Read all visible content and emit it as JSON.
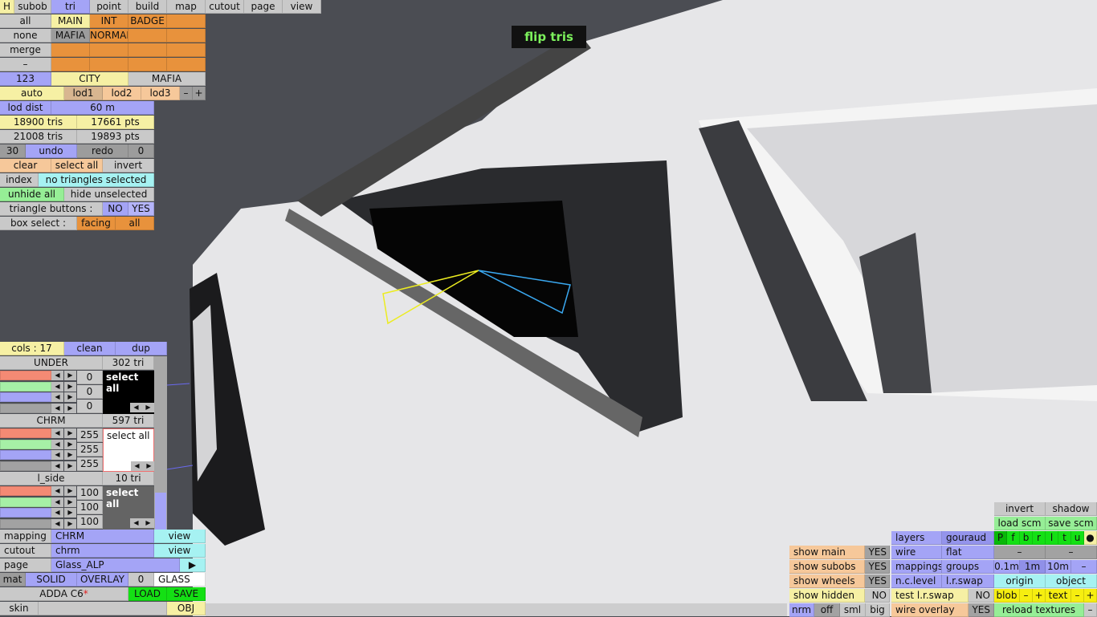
{
  "top_tabs": [
    "H",
    "subob",
    "tri",
    "point",
    "build",
    "map",
    "cutout",
    "page",
    "view"
  ],
  "layers": {
    "left": [
      "all",
      "none",
      "merge",
      "–"
    ],
    "grid": [
      [
        "MAIN",
        "INT",
        "BADGE",
        ""
      ],
      [
        "MAFIA",
        "NORMAL",
        "",
        ""
      ],
      [
        "",
        "",
        "",
        ""
      ],
      [
        "",
        "",
        "",
        ""
      ]
    ]
  },
  "city_row": [
    "123",
    "CITY",
    "MAFIA"
  ],
  "lod_row": [
    "auto",
    "lod1",
    "lod2",
    "lod3",
    "–",
    "+"
  ],
  "lod_dist": {
    "label": "lod dist",
    "value": "60 m"
  },
  "counts": [
    [
      "18900 tris",
      "17661 pts"
    ],
    [
      "21008 tris",
      "19893 pts"
    ]
  ],
  "undo_row": [
    "30",
    "undo",
    "redo",
    "0"
  ],
  "select_row": [
    "clear",
    "select all",
    "invert"
  ],
  "index_row": {
    "label": "index",
    "status": "no triangles selected"
  },
  "hide_row": [
    "unhide all",
    "hide unselected"
  ],
  "triangle_buttons": {
    "label": "triangle buttons :",
    "no": "NO",
    "yes": "YES"
  },
  "box_select": {
    "label": "box select :",
    "facing": "facing",
    "all": "all"
  },
  "tooltip": "flip tris",
  "cols": {
    "label": "cols : 17",
    "clean": "clean",
    "dup": "dup"
  },
  "materials": [
    {
      "name": "UNDER",
      "tris": "302 tri",
      "values": [
        "0",
        "0",
        "0"
      ],
      "select": "select all",
      "color": "#000000"
    },
    {
      "name": "CHRM",
      "tris": "597 tri",
      "values": [
        "255",
        "255",
        "255"
      ],
      "select": "select all",
      "color": "#ffffff"
    },
    {
      "name": "l_side",
      "tris": "10 tri",
      "values": [
        "100",
        "100",
        "100"
      ],
      "select": "select all",
      "color": "#646464"
    }
  ],
  "mapping": {
    "label": "mapping",
    "value": "CHRM",
    "view": "view"
  },
  "cutout": {
    "label": "cutout",
    "value": "chrm",
    "view": "view"
  },
  "page": {
    "label": "page",
    "value": "Glass_ALP",
    "arrow": "▶"
  },
  "mat": {
    "label": "mat",
    "solid": "SOLID",
    "overlay": "OVERLAY",
    "num": "0",
    "name": "GLASS"
  },
  "file": {
    "name": "ADDA C6",
    "modified": "*",
    "load": "LOAD",
    "save": "SAVE"
  },
  "skin": {
    "label": "skin",
    "value": "",
    "obj": "OBJ"
  },
  "right": {
    "invert": "invert",
    "shadow": "shadow",
    "load_scm": "load scm",
    "save_scm": "save scm",
    "views": [
      "P",
      "f",
      "b",
      "r",
      "l",
      "t",
      "u",
      "●"
    ],
    "dash1": "–",
    "dash2": "–",
    "grid": [
      "0.1m",
      "1m",
      "10m",
      "–"
    ],
    "origin": "origin",
    "object": "object",
    "blob": [
      "blob",
      "–",
      "+"
    ],
    "text": [
      "text",
      "–",
      "+"
    ],
    "reload": "reload textures",
    "reload_minus": "–"
  },
  "render": {
    "layers": "layers",
    "gouraud": "gouraud",
    "wire": "wire",
    "flat": "flat",
    "mappings": "mappings",
    "groups": "groups",
    "nclevel": "n.c.level",
    "lrswap": "l.r.swap",
    "test": "test l.r.swap",
    "test_val": "NO",
    "overlay": "wire overlay",
    "overlay_val": "YES"
  },
  "show": [
    {
      "label": "show main",
      "val": "YES"
    },
    {
      "label": "show subobs",
      "val": "YES"
    },
    {
      "label": "show wheels",
      "val": "YES"
    },
    {
      "label": "show hidden",
      "val": "NO"
    }
  ],
  "size_row": [
    "nrm",
    "off",
    "sml",
    "big"
  ]
}
